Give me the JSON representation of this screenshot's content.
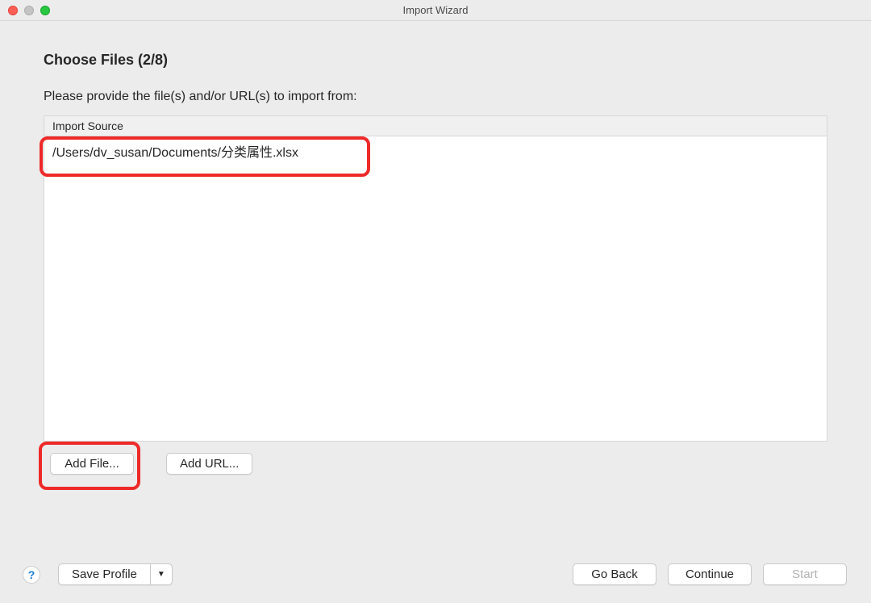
{
  "window": {
    "title": "Import Wizard"
  },
  "page": {
    "heading": "Choose Files (2/8)",
    "instruction": "Please provide the file(s) and/or URL(s) to import from:"
  },
  "table": {
    "header": "Import Source",
    "rows": [
      "/Users/dv_susan/Documents/分类属性.xlsx"
    ]
  },
  "buttons": {
    "add_file": "Add File...",
    "add_url": "Add URL...",
    "save_profile": "Save Profile",
    "go_back": "Go Back",
    "continue": "Continue",
    "start": "Start"
  },
  "help_icon_label": "?"
}
